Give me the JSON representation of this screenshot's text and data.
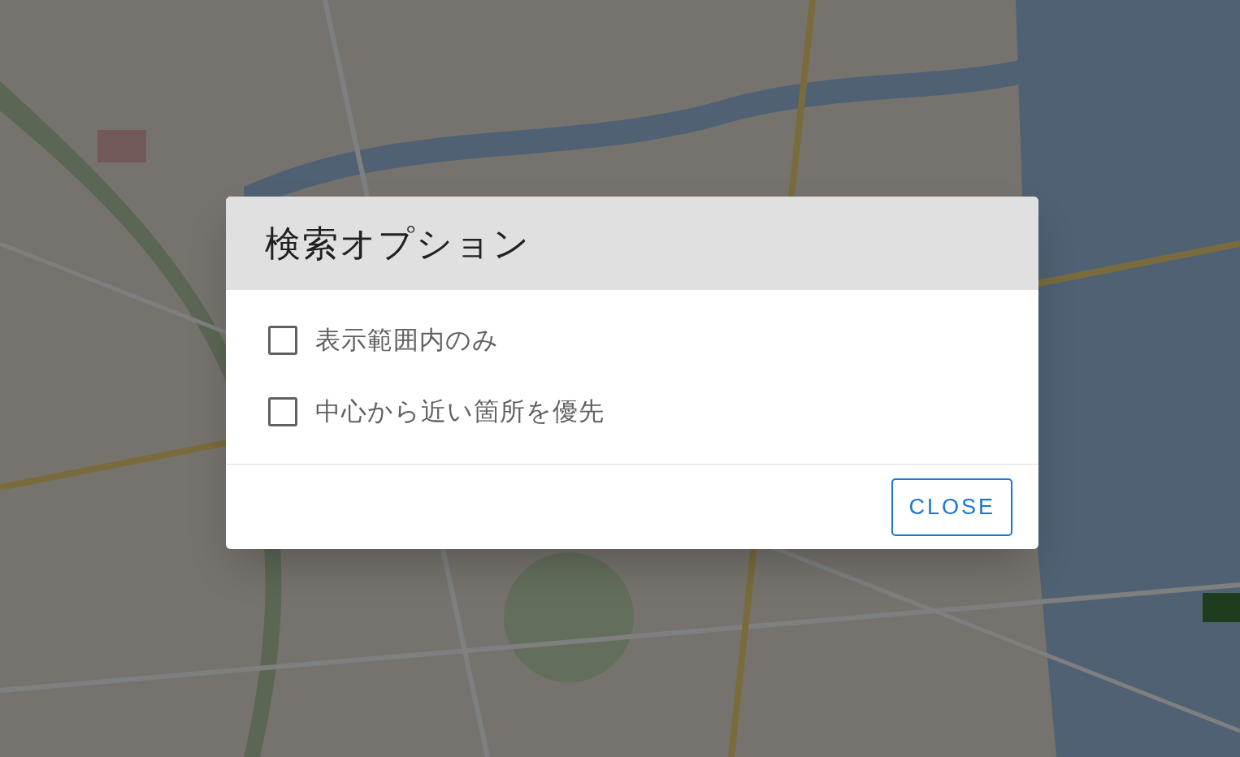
{
  "dialog": {
    "title": "検索オプション",
    "options": [
      {
        "label": "表示範囲内のみ",
        "checked": false
      },
      {
        "label": "中心から近い箇所を優先",
        "checked": false
      }
    ],
    "buttons": [
      "CLOSE"
    ]
  }
}
